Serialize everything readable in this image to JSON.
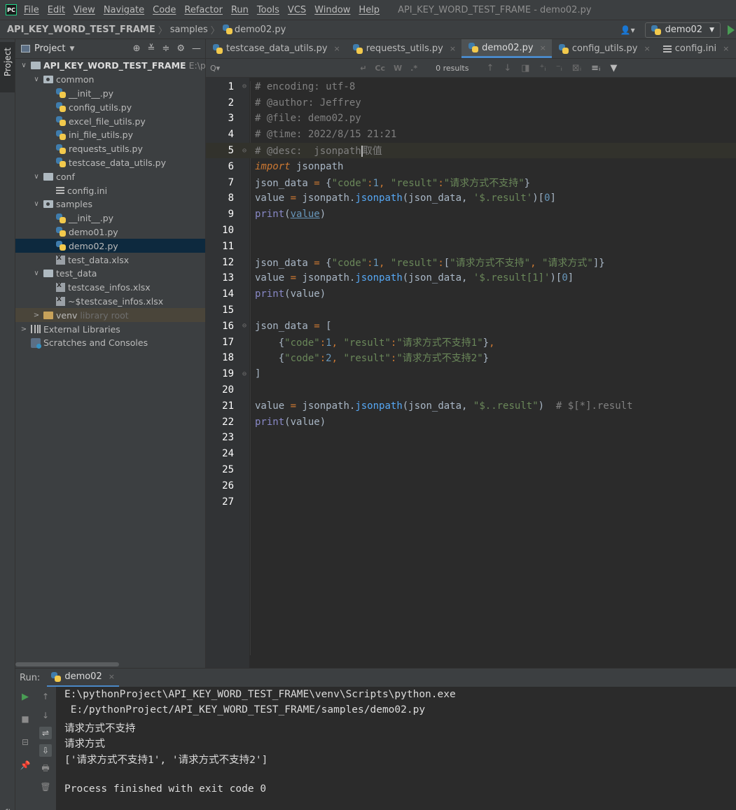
{
  "menubar": {
    "logo": "PC",
    "items": [
      "File",
      "Edit",
      "View",
      "Navigate",
      "Code",
      "Refactor",
      "Run",
      "Tools",
      "VCS",
      "Window",
      "Help"
    ],
    "window_title": "API_KEY_WORD_TEST_FRAME - demo02.py"
  },
  "navbar": {
    "breadcrumbs": [
      "API_KEY_WORD_TEST_FRAME",
      "samples",
      "demo02.py"
    ],
    "user_icon": "👤▾",
    "run_config": "demo02",
    "run_config_arrow": "▼"
  },
  "left_strip": {
    "project_tab": "Project",
    "structure_tab": "Structure"
  },
  "project_panel": {
    "title": "Project",
    "title_arrow": "▼",
    "header_icons": [
      "⊕",
      "≚",
      "≑",
      "⚙",
      "—"
    ],
    "tree": [
      {
        "label": "API_KEY_WORD_TEST_FRAME",
        "suffix": "E:\\pythc",
        "indent": 0,
        "chevron": "∨",
        "icon": "folder",
        "bold": true
      },
      {
        "label": "common",
        "indent": 1,
        "chevron": "∨",
        "icon": "package"
      },
      {
        "label": "__init__.py",
        "indent": 2,
        "icon": "py"
      },
      {
        "label": "config_utils.py",
        "indent": 2,
        "icon": "py"
      },
      {
        "label": "excel_file_utils.py",
        "indent": 2,
        "icon": "py"
      },
      {
        "label": "ini_file_utils.py",
        "indent": 2,
        "icon": "py"
      },
      {
        "label": "requests_utils.py",
        "indent": 2,
        "icon": "py"
      },
      {
        "label": "testcase_data_utils.py",
        "indent": 2,
        "icon": "py"
      },
      {
        "label": "conf",
        "indent": 1,
        "chevron": "∨",
        "icon": "folder"
      },
      {
        "label": "config.ini",
        "indent": 2,
        "icon": "ini"
      },
      {
        "label": "samples",
        "indent": 1,
        "chevron": "∨",
        "icon": "package"
      },
      {
        "label": "__init__.py",
        "indent": 2,
        "icon": "py"
      },
      {
        "label": "demo01.py",
        "indent": 2,
        "icon": "py"
      },
      {
        "label": "demo02.py",
        "indent": 2,
        "icon": "py",
        "selected": true
      },
      {
        "label": "test_data.xlsx",
        "indent": 2,
        "icon": "xls"
      },
      {
        "label": "test_data",
        "indent": 1,
        "chevron": "∨",
        "icon": "folder"
      },
      {
        "label": "testcase_infos.xlsx",
        "indent": 2,
        "icon": "xls"
      },
      {
        "label": "~$testcase_infos.xlsx",
        "indent": 2,
        "icon": "xls"
      },
      {
        "label": "venv",
        "suffix": "library root",
        "indent": 1,
        "chevron": ">",
        "icon": "venv",
        "venv": true
      },
      {
        "label": "External Libraries",
        "indent": 0,
        "chevron": ">",
        "icon": "lib"
      },
      {
        "label": "Scratches and Consoles",
        "indent": 0,
        "icon": "scratch"
      }
    ]
  },
  "editor_tabs": [
    {
      "label": "testcase_data_utils.py",
      "icon": "py",
      "close": "×"
    },
    {
      "label": "requests_utils.py",
      "icon": "py",
      "close": "×"
    },
    {
      "label": "demo02.py",
      "icon": "py",
      "close": "×",
      "active": true
    },
    {
      "label": "config_utils.py",
      "icon": "py",
      "close": "×"
    },
    {
      "label": "config.ini",
      "icon": "ini",
      "close": "×"
    }
  ],
  "find_bar": {
    "search_icon": "Q▾",
    "value": "",
    "placeholder": "",
    "wrap_icon": "↵",
    "match_case": "Cc",
    "words": "W",
    "regex": ".*",
    "results": "0 results",
    "nav_icons": [
      "↑",
      "↓",
      "◨",
      "⁺ᵢ",
      "⁻ᵢ",
      "⊠ᵢ",
      "≡ᵢ",
      "▼"
    ]
  },
  "editor": {
    "current_line": 5,
    "lines": [
      {
        "n": "1",
        "fold": "⊖",
        "tokens": [
          [
            "c-comment2",
            "# encoding: utf-8"
          ]
        ]
      },
      {
        "n": "2",
        "tokens": [
          [
            "c-comment2",
            "# @author: Jeffrey"
          ]
        ]
      },
      {
        "n": "3",
        "tokens": [
          [
            "c-comment2",
            "# @file: demo02.py"
          ]
        ]
      },
      {
        "n": "4",
        "tokens": [
          [
            "c-comment2",
            "# @time: 2022/8/15 21:21"
          ]
        ]
      },
      {
        "n": "5",
        "fold": "⊖",
        "tokens": [
          [
            "c-comment2",
            "# @desc:  jsonpath"
          ],
          [
            "caret",
            ""
          ],
          [
            "c-comment2",
            "取值"
          ]
        ]
      },
      {
        "n": "6",
        "tokens": [
          [
            "c-kw",
            "import"
          ],
          [
            "c-var",
            " jsonpath"
          ]
        ]
      },
      {
        "n": "7",
        "tokens": [
          [
            "c-var",
            "json_data "
          ],
          [
            "c-sym",
            "="
          ],
          [
            "c-var",
            " {"
          ],
          [
            "c-str",
            "\"code\""
          ],
          [
            "c-sym",
            ":"
          ],
          [
            "c-num",
            "1"
          ],
          [
            "c-sym",
            ","
          ],
          [
            "c-var",
            " "
          ],
          [
            "c-str",
            "\"result\""
          ],
          [
            "c-sym",
            ":"
          ],
          [
            "c-str",
            "\"请求方式不支持\""
          ],
          [
            "c-var",
            "}"
          ]
        ]
      },
      {
        "n": "8",
        "tokens": [
          [
            "c-var",
            "value "
          ],
          [
            "c-sym",
            "="
          ],
          [
            "c-var",
            " jsonpath."
          ],
          [
            "c-func",
            "jsonpath"
          ],
          [
            "c-var",
            "(json_data, "
          ],
          [
            "c-str",
            "'$.result'"
          ],
          [
            "c-var",
            ")["
          ],
          [
            "c-num",
            "0"
          ],
          [
            "c-var",
            "]"
          ]
        ]
      },
      {
        "n": "9",
        "tokens": [
          [
            "c-builtin",
            "print"
          ],
          [
            "c-var",
            "("
          ],
          [
            "c-link",
            "value"
          ],
          [
            "c-var",
            ")"
          ]
        ]
      },
      {
        "n": "10",
        "tokens": []
      },
      {
        "n": "11",
        "tokens": []
      },
      {
        "n": "12",
        "tokens": [
          [
            "c-var",
            "json_data "
          ],
          [
            "c-sym",
            "="
          ],
          [
            "c-var",
            " {"
          ],
          [
            "c-str",
            "\"code\""
          ],
          [
            "c-sym",
            ":"
          ],
          [
            "c-num",
            "1"
          ],
          [
            "c-sym",
            ","
          ],
          [
            "c-var",
            " "
          ],
          [
            "c-str",
            "\"result\""
          ],
          [
            "c-sym",
            ":"
          ],
          [
            "c-var",
            "["
          ],
          [
            "c-str",
            "\"请求方式不支持\""
          ],
          [
            "c-sym",
            ","
          ],
          [
            "c-var",
            " "
          ],
          [
            "c-str",
            "\"请求方式\""
          ],
          [
            "c-var",
            "]}"
          ]
        ]
      },
      {
        "n": "13",
        "tokens": [
          [
            "c-var",
            "value "
          ],
          [
            "c-sym",
            "="
          ],
          [
            "c-var",
            " jsonpath."
          ],
          [
            "c-func",
            "jsonpath"
          ],
          [
            "c-var",
            "(json_data, "
          ],
          [
            "c-str",
            "'$.result[1]'"
          ],
          [
            "c-var",
            ")["
          ],
          [
            "c-num",
            "0"
          ],
          [
            "c-var",
            "]"
          ]
        ]
      },
      {
        "n": "14",
        "tokens": [
          [
            "c-builtin",
            "print"
          ],
          [
            "c-var",
            "(value)"
          ]
        ]
      },
      {
        "n": "15",
        "tokens": []
      },
      {
        "n": "16",
        "fold": "⊖",
        "tokens": [
          [
            "c-var",
            "json_data "
          ],
          [
            "c-sym",
            "="
          ],
          [
            "c-var",
            " ["
          ]
        ]
      },
      {
        "n": "17",
        "tokens": [
          [
            "c-var",
            "    {"
          ],
          [
            "c-str",
            "\"code\""
          ],
          [
            "c-sym",
            ":"
          ],
          [
            "c-num",
            "1"
          ],
          [
            "c-sym",
            ","
          ],
          [
            "c-var",
            " "
          ],
          [
            "c-str",
            "\"result\""
          ],
          [
            "c-sym",
            ":"
          ],
          [
            "c-str",
            "\"请求方式不支持1\""
          ],
          [
            "c-var",
            "}"
          ],
          [
            "c-sym",
            ","
          ]
        ]
      },
      {
        "n": "18",
        "tokens": [
          [
            "c-var",
            "    {"
          ],
          [
            "c-str",
            "\"code\""
          ],
          [
            "c-sym",
            ":"
          ],
          [
            "c-num",
            "2"
          ],
          [
            "c-sym",
            ","
          ],
          [
            "c-var",
            " "
          ],
          [
            "c-str",
            "\"result\""
          ],
          [
            "c-sym",
            ":"
          ],
          [
            "c-str",
            "\"请求方式不支持2\""
          ],
          [
            "c-var",
            "}"
          ]
        ]
      },
      {
        "n": "19",
        "fold": "⊖",
        "tokens": [
          [
            "c-var",
            "]"
          ]
        ]
      },
      {
        "n": "20",
        "tokens": []
      },
      {
        "n": "21",
        "tokens": [
          [
            "c-var",
            "value "
          ],
          [
            "c-sym",
            "="
          ],
          [
            "c-var",
            " jsonpath."
          ],
          [
            "c-func",
            "jsonpath"
          ],
          [
            "c-var",
            "(json_data, "
          ],
          [
            "c-str",
            "\"$..result\""
          ],
          [
            "c-var",
            ")  "
          ],
          [
            "c-comment2",
            "# $[*].result"
          ]
        ]
      },
      {
        "n": "22",
        "tokens": [
          [
            "c-builtin",
            "print"
          ],
          [
            "c-var",
            "(value)"
          ]
        ]
      },
      {
        "n": "23",
        "tokens": []
      },
      {
        "n": "24",
        "tokens": []
      },
      {
        "n": "25",
        "tokens": []
      },
      {
        "n": "26",
        "tokens": []
      },
      {
        "n": "27",
        "tokens": []
      }
    ]
  },
  "run_panel": {
    "label": "Run:",
    "tab": "demo02",
    "tab_close": "×",
    "toolbar_icons": [
      "▶",
      "↑",
      "■",
      "↓",
      "⊟",
      "⇌",
      "⇩",
      "📌",
      "🖶",
      "🗑"
    ],
    "console": [
      "E:\\pythonProject\\API_KEY_WORD_TEST_FRAME\\venv\\Scripts\\python.exe",
      " E:/pythonProject/API_KEY_WORD_TEST_FRAME/samples/demo02.py",
      "请求方式不支持",
      "请求方式",
      "['请求方式不支持1', '请求方式不支持2']",
      "",
      "Process finished with exit code 0"
    ]
  }
}
